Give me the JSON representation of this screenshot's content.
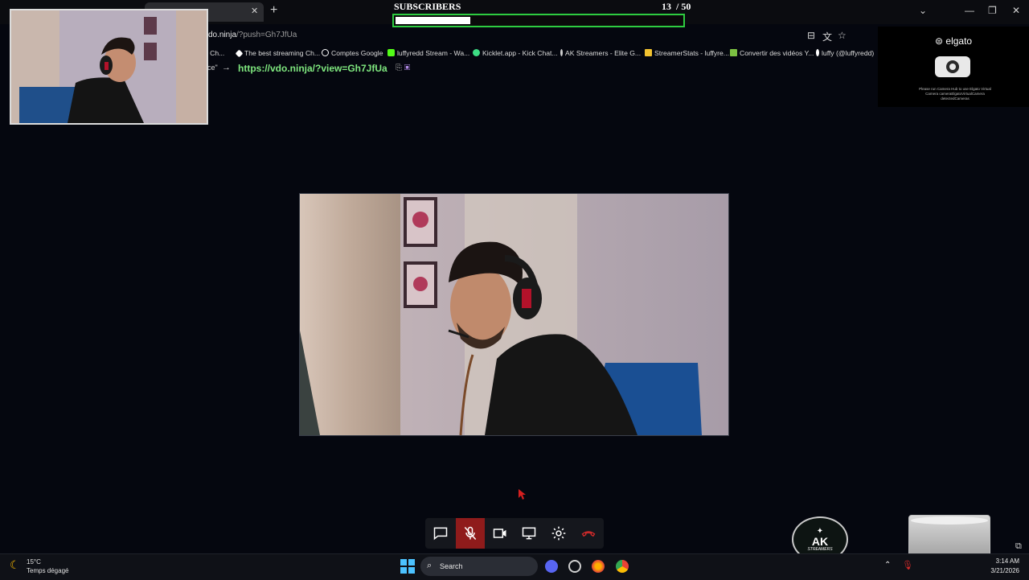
{
  "browser": {
    "address_host": "vdo.ninja",
    "address_path": "/?push=Gh7JfUa",
    "bookmarks": [
      {
        "label": "g Ch...",
        "color": "#49a74d"
      },
      {
        "label": "The best streaming Ch...",
        "color": "#ffffff"
      },
      {
        "label": "Comptes Google",
        "color": "#ffffff"
      },
      {
        "label": "luffyredd Stream - Wa...",
        "color": "#53fc18"
      },
      {
        "label": "Kicklet.app - Kick Chat...",
        "color": "#3ddc84"
      },
      {
        "label": "AK Streamers - Elite G...",
        "color": "#cfcfcf"
      },
      {
        "label": "StreamerStats - luffyre...",
        "color": "#f2c230"
      },
      {
        "label": "Convertir des vidéos Y...",
        "color": "#7cc142"
      },
      {
        "label": "luffy (@luffyredd)",
        "color": "#ffffff"
      }
    ]
  },
  "subscribers": {
    "label": "SUBSCRIBERS",
    "current": "13",
    "goal": "/ 50",
    "progress": 0.26,
    "bar_color": "#2ecc40"
  },
  "page": {
    "view_prefix": "ce\"",
    "view_arrow": "→",
    "view_link": "https://vdo.ninja/?view=Gh7JfUa"
  },
  "elgato": {
    "logo": "elgato",
    "caption": "Please run Camera Hub to use Elgato Virtual Camera cameraElgatoVirtualCamera detectedCameras"
  },
  "controls": [
    {
      "name": "chat-icon",
      "label": "chat"
    },
    {
      "name": "mic-muted-icon",
      "label": "mic",
      "active": true
    },
    {
      "name": "camera-icon",
      "label": "camera"
    },
    {
      "name": "screen-share-icon",
      "label": "screen"
    },
    {
      "name": "settings-icon",
      "label": "settings"
    },
    {
      "name": "hangup-icon",
      "label": "hangup"
    }
  ],
  "badge": {
    "title": "AK",
    "subtitle": "STREAMERS"
  },
  "taskbar": {
    "temperature": "15°C",
    "weather": "Temps dégagé",
    "search_placeholder": "Search",
    "time": "3:14 AM",
    "date": "3/21/2026"
  }
}
